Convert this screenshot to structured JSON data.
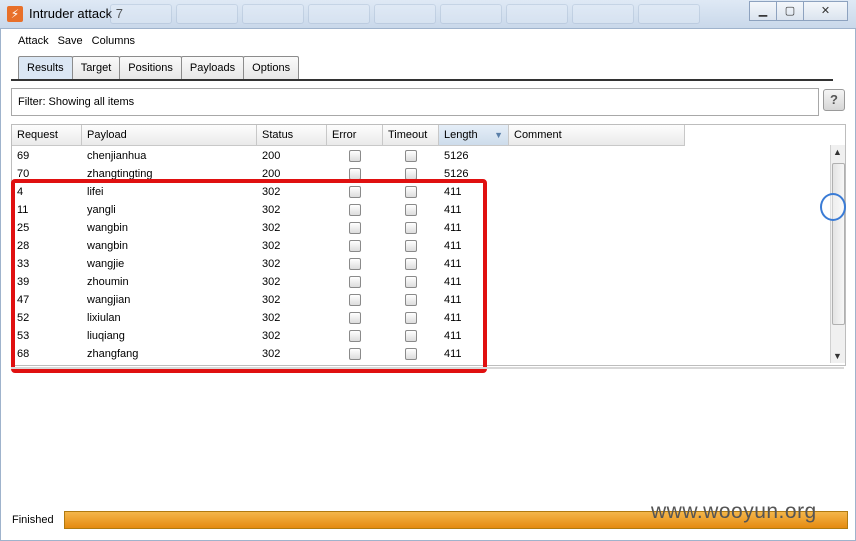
{
  "window": {
    "title": "Intruder attack 7",
    "icon": "burp-icon"
  },
  "menu": [
    "Attack",
    "Save",
    "Columns"
  ],
  "tabs": [
    "Results",
    "Target",
    "Positions",
    "Payloads",
    "Options"
  ],
  "active_tab": "Results",
  "filter": {
    "text": "Filter: Showing all items",
    "help_label": "?"
  },
  "table": {
    "columns": [
      "Request",
      "Payload",
      "Status",
      "Error",
      "Timeout",
      "Length",
      "Comment"
    ],
    "sorted_column": "Length",
    "rows": [
      {
        "request": "69",
        "payload": "chenjianhua",
        "status": "200",
        "error": false,
        "timeout": false,
        "length": "5126",
        "comment": ""
      },
      {
        "request": "70",
        "payload": "zhangtingting",
        "status": "200",
        "error": false,
        "timeout": false,
        "length": "5126",
        "comment": ""
      },
      {
        "request": "4",
        "payload": "lifei",
        "status": "302",
        "error": false,
        "timeout": false,
        "length": "411",
        "comment": ""
      },
      {
        "request": "11",
        "payload": "yangli",
        "status": "302",
        "error": false,
        "timeout": false,
        "length": "411",
        "comment": ""
      },
      {
        "request": "25",
        "payload": "wangbin",
        "status": "302",
        "error": false,
        "timeout": false,
        "length": "411",
        "comment": ""
      },
      {
        "request": "28",
        "payload": "wangbin",
        "status": "302",
        "error": false,
        "timeout": false,
        "length": "411",
        "comment": ""
      },
      {
        "request": "33",
        "payload": "wangjie",
        "status": "302",
        "error": false,
        "timeout": false,
        "length": "411",
        "comment": ""
      },
      {
        "request": "39",
        "payload": "zhoumin",
        "status": "302",
        "error": false,
        "timeout": false,
        "length": "411",
        "comment": ""
      },
      {
        "request": "47",
        "payload": "wangjian",
        "status": "302",
        "error": false,
        "timeout": false,
        "length": "411",
        "comment": ""
      },
      {
        "request": "52",
        "payload": "lixiulan",
        "status": "302",
        "error": false,
        "timeout": false,
        "length": "411",
        "comment": ""
      },
      {
        "request": "53",
        "payload": "liuqiang",
        "status": "302",
        "error": false,
        "timeout": false,
        "length": "411",
        "comment": ""
      },
      {
        "request": "68",
        "payload": "zhangfang",
        "status": "302",
        "error": false,
        "timeout": false,
        "length": "411",
        "comment": ""
      }
    ]
  },
  "status": {
    "label": "Finished",
    "progress": 1.0
  },
  "watermark": "www.wooyun.org",
  "colors": {
    "highlight": "#e01010",
    "progress": "#f0a030",
    "accent": "#3a7bd5"
  }
}
